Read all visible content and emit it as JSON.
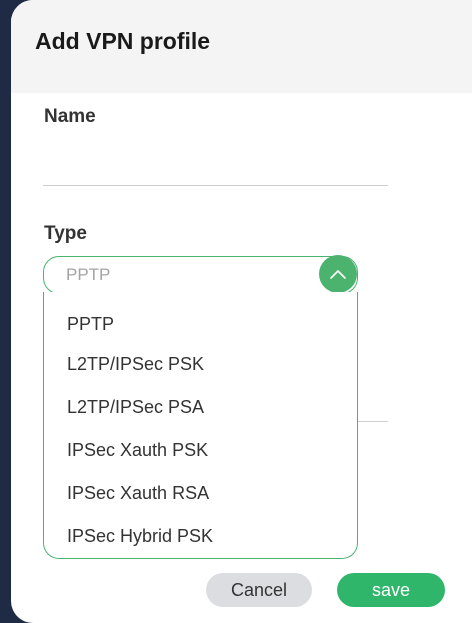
{
  "dialog": {
    "title": "Add VPN profile"
  },
  "name_field": {
    "label": "Name",
    "value": "",
    "placeholder": ""
  },
  "type_field": {
    "label": "Type",
    "selected": "PPTP",
    "options": [
      "PPTP",
      "L2TP/IPSec PSK",
      "L2TP/IPSec PSA",
      "IPSec Xauth PSK",
      "IPSec Xauth RSA",
      "IPSec Hybrid PSK"
    ],
    "toggle_icon": "chevron-up-icon"
  },
  "buttons": {
    "cancel": "Cancel",
    "save": "save"
  },
  "colors": {
    "accent": "#4cb36f",
    "save_button": "#2fb66b",
    "cancel_button": "#dcdde1",
    "header": "#f4f4f4",
    "backdrop": "#1f2a44"
  }
}
